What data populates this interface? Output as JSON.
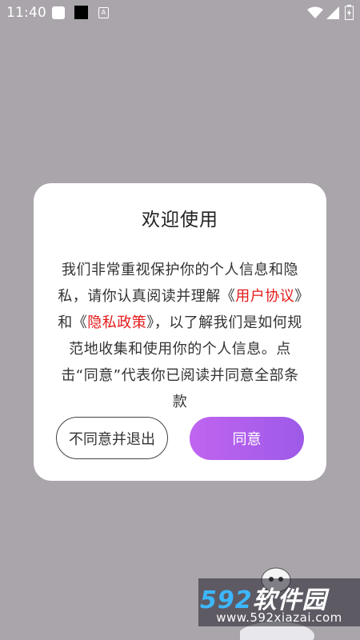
{
  "status_bar": {
    "time": "11:40",
    "notif_letter": "A"
  },
  "dialog": {
    "title": "欢迎使用",
    "body": {
      "part1": "我们非常重视保护你的个人信息和隐私，请你认真阅读并理解《",
      "link1": "用户协议",
      "part2": "》和《",
      "link2": "隐私政策",
      "part3": "》，以了解我们是如何规范地收集和使用你的个人信息。点击“同意”代表你已阅读并同意全部条款"
    },
    "decline_label": "不同意并退出",
    "agree_label": "同意",
    "colors": {
      "link": "#e41a1a",
      "agree_gradient_start": "#c064f0",
      "agree_gradient_end": "#9d5ae8"
    }
  },
  "watermark": {
    "logo_number": "592",
    "logo_text": "软件园",
    "url": "www.592xiazai.com"
  }
}
